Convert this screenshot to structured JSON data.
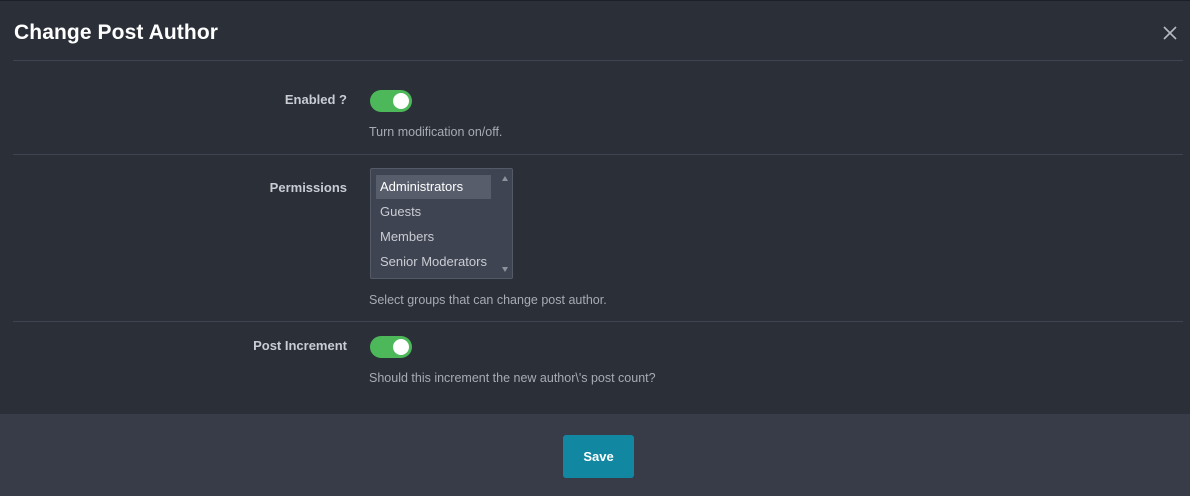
{
  "modal": {
    "title": "Change Post Author",
    "close_icon": "close-icon"
  },
  "settings": [
    {
      "label": "Enabled ?",
      "type": "toggle",
      "value": true,
      "help": "Turn modification on/off."
    },
    {
      "label": "Permissions",
      "type": "multiselect",
      "options": [
        "Administrators",
        "Guests",
        "Members",
        "Senior Moderators"
      ],
      "selected": [
        "Administrators"
      ],
      "help": "Select groups that can change post author."
    },
    {
      "label": "Post Increment",
      "type": "toggle",
      "value": true,
      "help": "Should this increment the new author\\'s post count?"
    }
  ],
  "footer": {
    "save_label": "Save"
  },
  "colors": {
    "background": "#2b2f38",
    "footer": "#383c48",
    "toggle_on": "#4cb85a",
    "save_button": "#1287a1"
  }
}
